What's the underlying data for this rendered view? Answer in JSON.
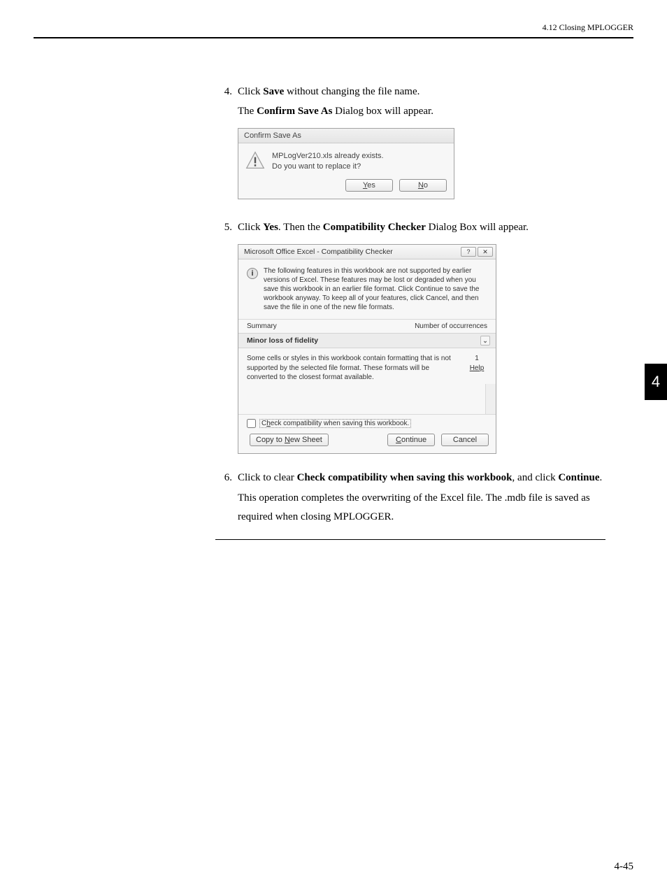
{
  "header": {
    "section": "4.12  Closing MPLOGGER"
  },
  "steps": {
    "s4": {
      "num": "4.",
      "pre": "Click ",
      "bold": "Save",
      "post": " without changing the file name.",
      "sub_pre": "The ",
      "sub_bold": "Confirm Save As",
      "sub_post": " Dialog box will appear."
    },
    "s5": {
      "num": "5.",
      "pre": "Click ",
      "bold1": "Yes",
      "mid": ". Then the ",
      "bold2": "Compatibility Checker",
      "post": " Dialog Box will appear."
    },
    "s6": {
      "num": "6.",
      "pre": "Click to clear ",
      "bold1": "Check compatibility when saving this workbook",
      "mid": ", and click ",
      "bold2": "Continue",
      "post": ".",
      "para": "This operation completes the overwriting of the Excel file. The .mdb file is saved as required when closing MPLOGGER."
    }
  },
  "dlg1": {
    "title": "Confirm Save As",
    "line1": "MPLogVer210.xls already exists.",
    "line2": "Do you want to replace it?",
    "yes": "Yes",
    "no": "No"
  },
  "dlg2": {
    "title": "Microsoft Office Excel - Compatibility Checker",
    "info": "The following features in this workbook are not supported by earlier versions of Excel. These features may be lost or degraded when you save this workbook in an earlier file format. Click Continue to save the workbook anyway. To keep all of your features, click Cancel, and then save the file in one of the new file formats.",
    "summary": "Summary",
    "occ": "Number of occurrences",
    "minor": "Minor loss of fidelity",
    "detail": "Some cells or styles in this workbook contain formatting that is not supported by the selected file format. These formats will be converted to the closest format available.",
    "count": "1",
    "help": "Help",
    "check_label": "Check compatibility when saving this workbook.",
    "copy": "Copy to New Sheet",
    "continue": "Continue",
    "cancel": "Cancel"
  },
  "sidetab": "4",
  "pagenum": "4-45"
}
